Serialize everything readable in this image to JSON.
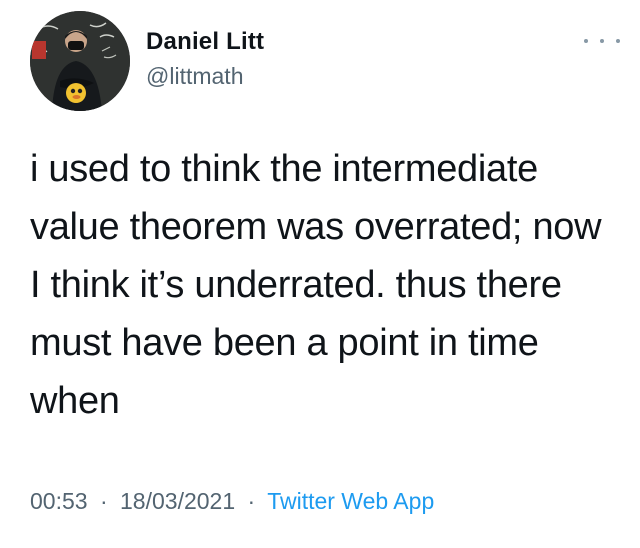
{
  "tweet": {
    "author": {
      "name": "Daniel Litt",
      "handle": "@littmath",
      "avatar_icon": "profile-photo"
    },
    "menu_icon": "more-options-icon",
    "text": "i used to think the intermediate value theorem was overrated; now I think it’s underrated. thus there must have been a point in time when",
    "time": "00:53",
    "date": "18/03/2021",
    "separator": "·",
    "source": "Twitter Web App",
    "colors": {
      "text": "#0f1419",
      "secondary": "#536471",
      "link": "#1d9bf0"
    }
  }
}
